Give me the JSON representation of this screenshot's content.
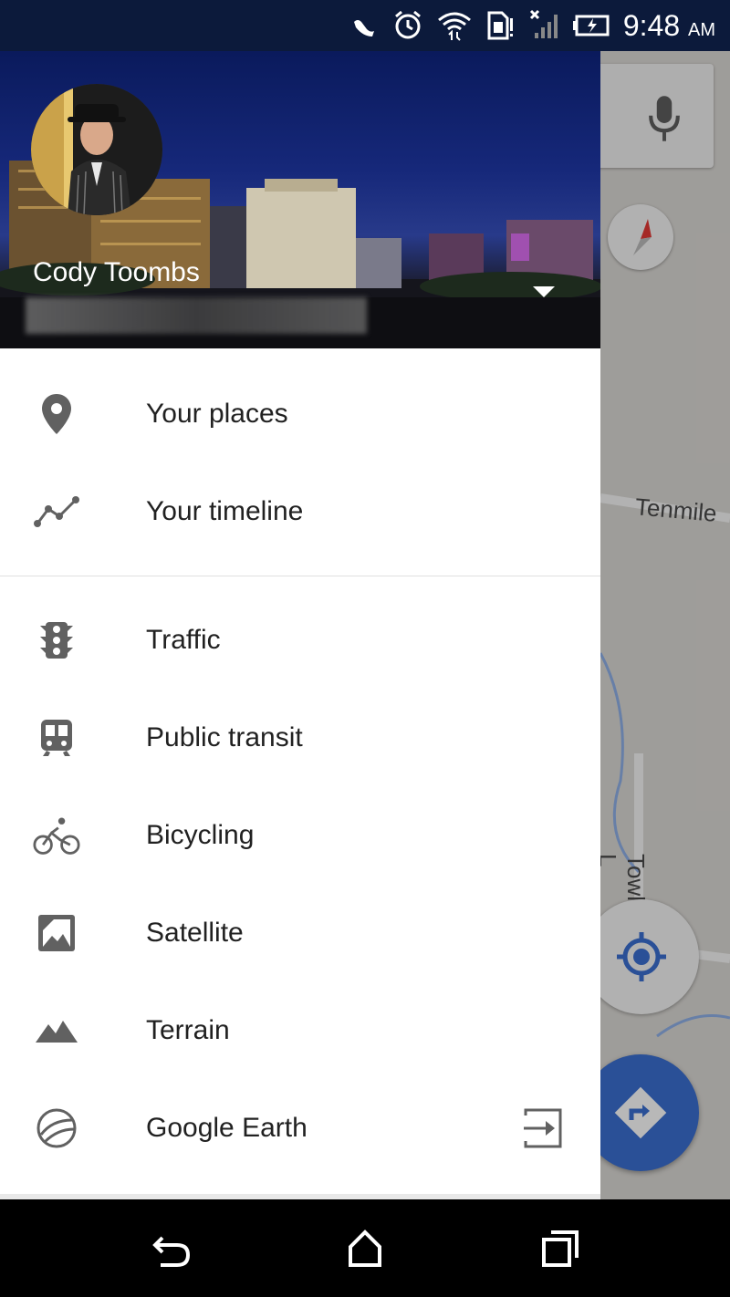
{
  "status_bar": {
    "time": "9:48",
    "ampm": "AM",
    "icons": [
      "missed-call-icon",
      "alarm-icon",
      "wifi-icon",
      "sim-icon",
      "signal-off-icon",
      "battery-charging-icon"
    ]
  },
  "drawer": {
    "user_name": "Cody Toombs",
    "sections": [
      {
        "items": [
          {
            "label": "Your places",
            "icon": "place-pin-icon"
          },
          {
            "label": "Your timeline",
            "icon": "timeline-icon"
          }
        ]
      },
      {
        "items": [
          {
            "label": "Traffic",
            "icon": "traffic-light-icon"
          },
          {
            "label": "Public transit",
            "icon": "transit-icon"
          },
          {
            "label": "Bicycling",
            "icon": "bicycle-icon"
          },
          {
            "label": "Satellite",
            "icon": "satellite-icon"
          },
          {
            "label": "Terrain",
            "icon": "terrain-icon"
          },
          {
            "label": "Google Earth",
            "icon": "google-earth-icon",
            "trailing_icon": "open-external-icon"
          }
        ]
      }
    ]
  },
  "map": {
    "road_labels": [
      "Tenmile",
      "Towhee L"
    ],
    "accent_color": "#3b6fd2"
  },
  "navbar": {
    "buttons": [
      "back-icon",
      "home-icon",
      "recents-icon"
    ]
  }
}
